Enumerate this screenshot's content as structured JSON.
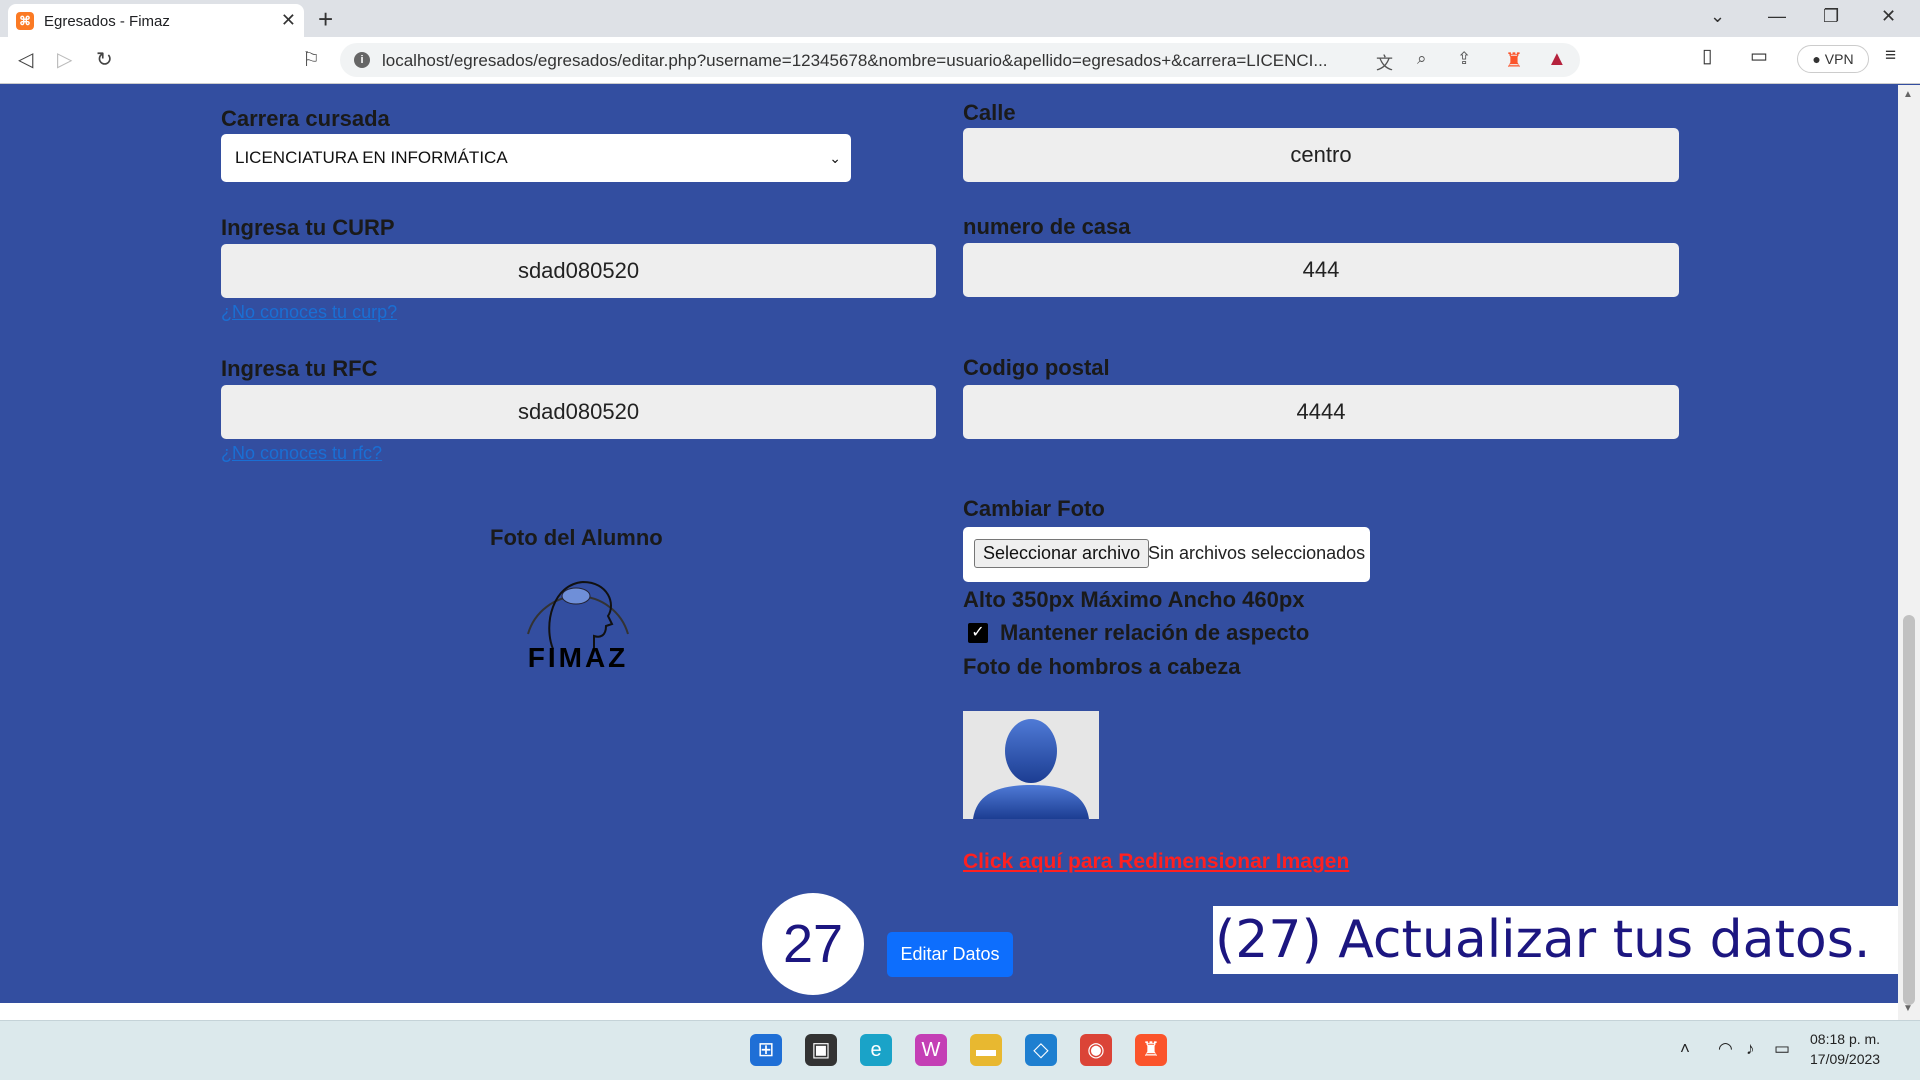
{
  "browser": {
    "tab_title": "Egresados - Fimaz",
    "url": "localhost/egresados/egresados/editar.php?username=12345678&nombre=usuario&apellido=egresados+&carrera=LICENCI...",
    "vpn_label": "VPN"
  },
  "form": {
    "carrera_label": "Carrera cursada",
    "carrera_value": "LICENCIATURA EN INFORMÁTICA",
    "calle_label": "Calle",
    "calle_value": "centro",
    "curp_label": "Ingresa tu CURP",
    "curp_value": "sdad080520",
    "curp_link": "¿No conoces tu curp?",
    "numero_label": "numero de casa",
    "numero_value": "444",
    "rfc_label": "Ingresa tu RFC",
    "rfc_value": "sdad080520",
    "rfc_link": "¿No conoces tu rfc?",
    "cp_label": "Codigo postal",
    "cp_value": "4444",
    "foto_label": "Foto del Alumno",
    "logo_text": "FIMAZ",
    "cambiar_label": "Cambiar Foto",
    "file_button": "Seleccionar archivo",
    "file_none": "Sin archivos seleccionados",
    "size_note": "Alto 350px Máximo Ancho 460px",
    "aspect_label": "Mantener relación de aspecto",
    "aspect_checked": true,
    "hombros_note": "Foto de hombros a cabeza",
    "resize_link": "Click aquí para Redimensionar Imagen",
    "submit_label": "Editar Datos"
  },
  "overlay": {
    "step_number": "27",
    "caption": "(27) Actualizar tus datos."
  },
  "taskbar": {
    "time": "08:18 p. m.",
    "date": "17/09/2023"
  },
  "colors": {
    "page_bg": "#334ea0",
    "primary_button": "#0d6efd",
    "resize_link": "#ff2020",
    "caption_text": "#1c1680"
  }
}
